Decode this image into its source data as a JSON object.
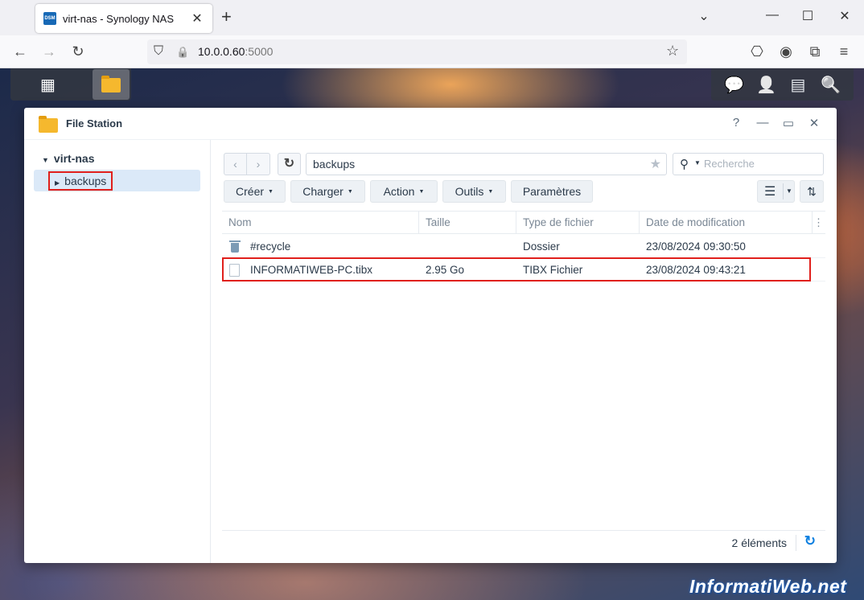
{
  "browser": {
    "tab": {
      "favicon_text": "DSM",
      "title": "virt-nas - Synology NAS",
      "close": "✕"
    },
    "new_tab": "+",
    "url": {
      "host": "10.0.0.60",
      "port": ":5000"
    },
    "icons": {
      "back": "←",
      "forward": "→",
      "reload": "↻",
      "shield": "⛉",
      "lock": "🔒",
      "star": "☆",
      "pocket": "⎔",
      "account": "◉",
      "extensions": "⧉",
      "menu": "≡",
      "tab_list": "⌄",
      "minimize": "—",
      "maximize": "☐",
      "close": "✕"
    }
  },
  "taskbar": {
    "main_menu_icon": "▦",
    "right_icons": {
      "chat": "💬",
      "user": "👤",
      "widgets": "▤",
      "search": "🔍"
    }
  },
  "window": {
    "title": "File Station",
    "controls": {
      "help": "?",
      "minimize": "—",
      "maximize": "▭",
      "close": "✕"
    },
    "tree": {
      "root": "virt-nas",
      "selected": "backups",
      "root_caret": "▼",
      "item_caret": "▶"
    },
    "toolbar": {
      "back": "‹",
      "forward": "›",
      "refresh": "↻",
      "path": "backups",
      "favorite": "★",
      "search_placeholder": "Recherche",
      "buttons": {
        "create": "Créer",
        "upload": "Charger",
        "action": "Action",
        "tools": "Outils",
        "settings": "Paramètres"
      },
      "dropdown": "▼",
      "view_list": "☰",
      "sort": "⇅"
    },
    "columns": {
      "name": "Nom",
      "size": "Taille",
      "type": "Type de fichier",
      "modified": "Date de modification",
      "more": "⋮"
    },
    "rows": [
      {
        "name": "#recycle",
        "size": "",
        "type": "Dossier",
        "modified": "23/08/2024 09:30:50",
        "icon": "trash-icon"
      },
      {
        "name": "INFORMATIWEB-PC.tibx",
        "size": "2.95 Go",
        "type": "TIBX Fichier",
        "modified": "23/08/2024 09:43:21",
        "icon": "file-icon"
      }
    ],
    "footer": {
      "count": "2 éléments",
      "refresh": "↻"
    }
  },
  "watermark": "InformatiWeb.net",
  "colors": {
    "highlight": "#e0201c",
    "selection": "#dbe9f8",
    "accent": "#0b7fe0"
  }
}
